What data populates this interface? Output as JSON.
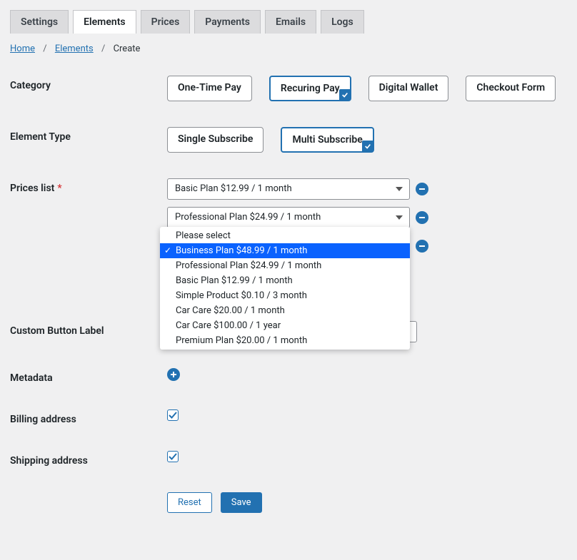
{
  "tabs": {
    "settings": "Settings",
    "elements": "Elements",
    "prices": "Prices",
    "payments": "Payments",
    "emails": "Emails",
    "logs": "Logs"
  },
  "breadcrumb": {
    "home": "Home",
    "elements": "Elements",
    "create": "Create"
  },
  "labels": {
    "category": "Category",
    "element_type": "Element Type",
    "prices_list": "Prices list",
    "custom_button": "Custom Button Label",
    "metadata": "Metadata",
    "billing": "Billing address",
    "shipping": "Shipping address"
  },
  "category_options": {
    "onetime": "One-Time Pay",
    "recurring": "Recuring Pay",
    "digital": "Digital Wallet",
    "checkout": "Checkout Form"
  },
  "element_type_options": {
    "single": "Single Subscribe",
    "multi": "Multi Subscribe"
  },
  "price_selects": {
    "row0": "Basic Plan $12.99 / 1 month",
    "row1": "Professional Plan $24.99 / 1 month"
  },
  "dropdown": {
    "items": [
      "Please select",
      "Business Plan $48.99 / 1 month",
      "Professional Plan $24.99 / 1 month",
      "Basic Plan $12.99 / 1 month",
      "Simple Product $0.10 / 3 month",
      "Car Care $20.00 / 1 month",
      "Car Care $100.00 / 1 year",
      "Premium Plan $20.00 / 1 month"
    ],
    "selected_index": 1
  },
  "buttons": {
    "reset": "Reset",
    "save": "Save"
  },
  "custom_button_value": "",
  "billing_checked": true,
  "shipping_checked": true
}
